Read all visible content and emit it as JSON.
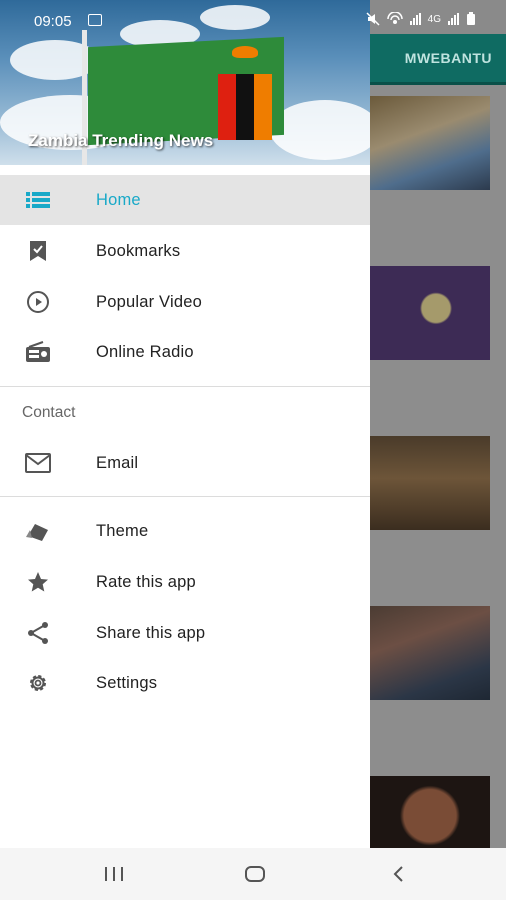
{
  "status_bar": {
    "time": "09:05",
    "network_label": "4G"
  },
  "background_app": {
    "tab_label": "MWEBANTU"
  },
  "drawer": {
    "title": "Zambia Trending News",
    "accent_color": "#19a9c8",
    "menu_items": [
      {
        "label": "Home",
        "icon": "list-icon",
        "active": true
      },
      {
        "label": "Bookmarks",
        "icon": "bookmark-icon"
      },
      {
        "label": "Popular Video",
        "icon": "play-circle-icon"
      },
      {
        "label": "Online Radio",
        "icon": "radio-icon"
      }
    ],
    "contact_section": {
      "heading": "Contact",
      "items": [
        {
          "label": "Email",
          "icon": "email-icon"
        }
      ]
    },
    "other_items": [
      {
        "label": "Theme",
        "icon": "theme-icon"
      },
      {
        "label": "Rate this app",
        "icon": "star-icon"
      },
      {
        "label": "Share this app",
        "icon": "share-icon"
      },
      {
        "label": "Settings",
        "icon": "gear-icon"
      }
    ]
  },
  "nav_bar": {
    "buttons": [
      "recents-icon",
      "home-icon",
      "back-icon"
    ]
  }
}
